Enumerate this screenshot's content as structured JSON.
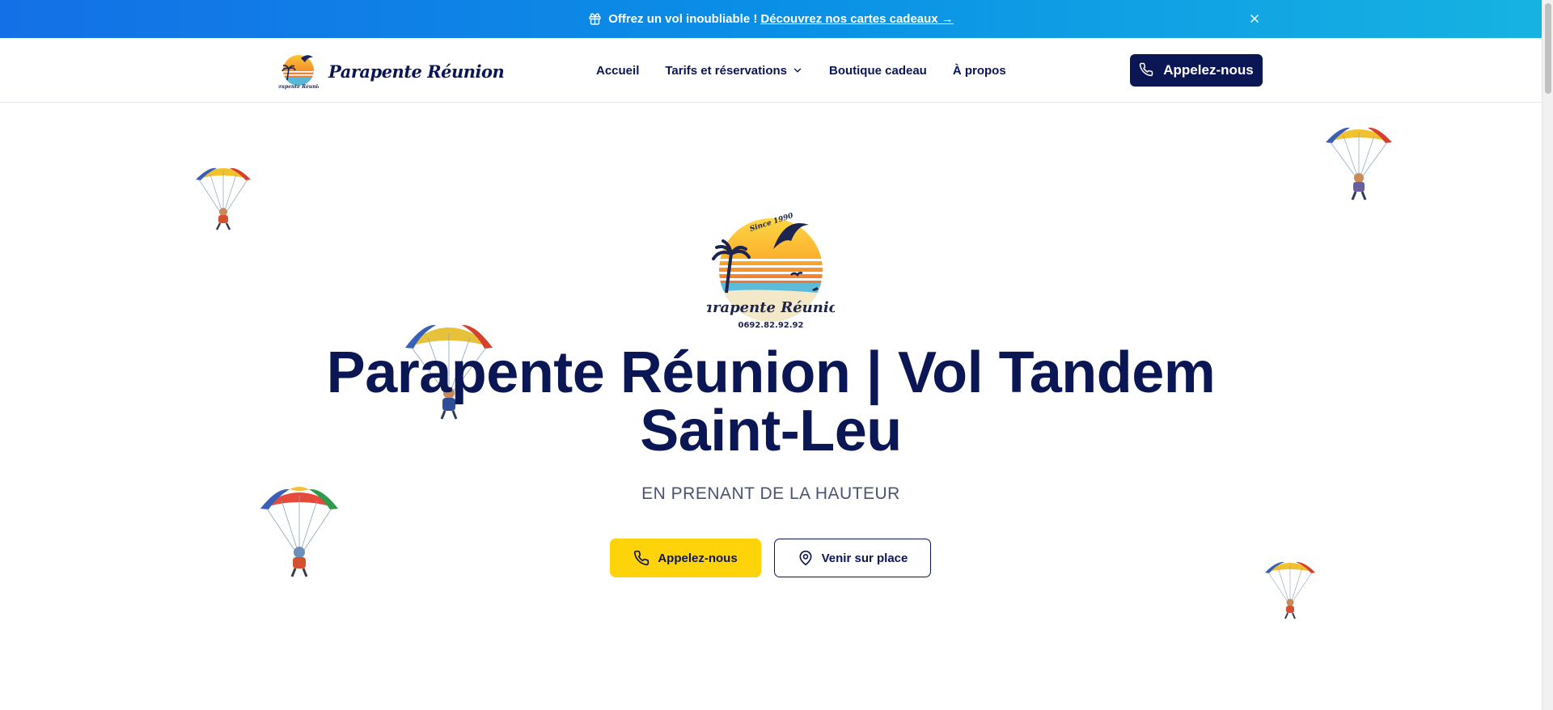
{
  "promo": {
    "text": "Offrez un vol inoubliable !",
    "link": "Découvrez nos cartes cadeaux →",
    "gift_icon": "gift-icon",
    "close_icon": "close-icon"
  },
  "header": {
    "brand_name": "Parapente Réunion",
    "nav": [
      {
        "label": "Accueil"
      },
      {
        "label": "Tarifs et réservations",
        "has_dropdown": true
      },
      {
        "label": "Boutique cadeau"
      },
      {
        "label": "À propos"
      }
    ],
    "cta_label": "Appelez-nous",
    "cta_icon": "phone-icon"
  },
  "hero": {
    "logo_badge": "Since 1990",
    "logo_name": "Parapente Réunion",
    "logo_phone": "0692.82.92.92",
    "title_line1": "Parapente Réunion | Vol Tandem",
    "title_line2": "Saint-Leu",
    "subtitle": "EN PRENANT DE LA HAUTEUR",
    "primary_button": "Appelez-nous",
    "secondary_button": "Venir sur place",
    "secondary_icon": "map-pin-icon"
  },
  "colors": {
    "navy": "#0b1654",
    "yellow": "#ffd30a",
    "promo_gradient_start": "#1470e6",
    "promo_gradient_end": "#16b3e2"
  }
}
